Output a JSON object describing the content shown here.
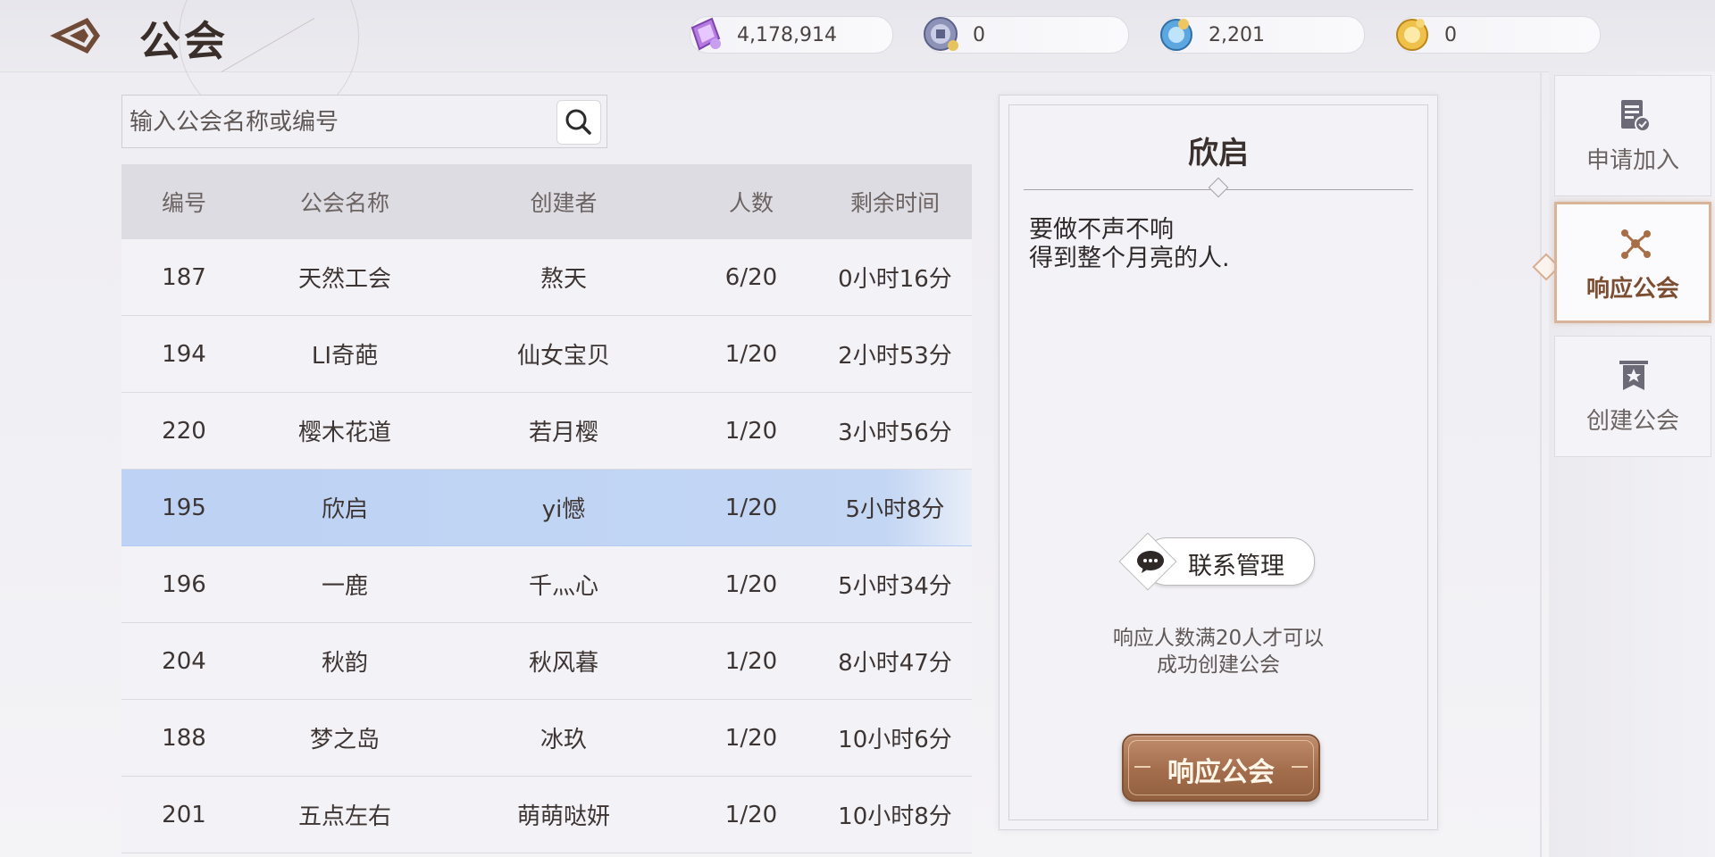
{
  "header": {
    "title": "公会",
    "back_icon": "back-arrow-icon"
  },
  "currencies": [
    {
      "name": "crystal",
      "icon": "crystal-icon",
      "value": "4,178,914"
    },
    {
      "name": "silver-coin",
      "icon": "coin-icon",
      "value": "0"
    },
    {
      "name": "blue-orb",
      "icon": "blue-orb-icon",
      "value": "2,201"
    },
    {
      "name": "gold-orb",
      "icon": "gold-orb-icon",
      "value": "0"
    }
  ],
  "search": {
    "placeholder": "输入公会名称或编号",
    "value": "",
    "icon": "search-icon"
  },
  "table": {
    "headers": [
      "编号",
      "公会名称",
      "创建者",
      "人数",
      "剩余时间"
    ],
    "rows": [
      {
        "id": "187",
        "name": "天然工会",
        "creator": "熬天",
        "members": "6/20",
        "time": "0小时16分"
      },
      {
        "id": "194",
        "name": "LI奇葩",
        "creator": "仙女宝贝",
        "members": "1/20",
        "time": "2小时53分"
      },
      {
        "id": "220",
        "name": "樱木花道",
        "creator": "若月樱",
        "members": "1/20",
        "time": "3小时56分"
      },
      {
        "id": "195",
        "name": "欣启",
        "creator": "yi憾",
        "members": "1/20",
        "time": "5小时8分"
      },
      {
        "id": "196",
        "name": "一鹿",
        "creator": "千灬心",
        "members": "1/20",
        "time": "5小时34分"
      },
      {
        "id": "204",
        "name": "秋韵",
        "creator": "秋风暮",
        "members": "1/20",
        "time": "8小时47分"
      },
      {
        "id": "188",
        "name": "梦之岛",
        "creator": "冰玖",
        "members": "1/20",
        "time": "10小时6分"
      },
      {
        "id": "201",
        "name": "五点左右",
        "creator": "萌萌哒妍",
        "members": "1/20",
        "time": "10小时8分"
      }
    ],
    "selected_row_index": 3
  },
  "detail": {
    "guild_name": "欣启",
    "motto": "要做不声不响\n得到整个月亮的人.",
    "contact_label": "联系管理",
    "hint": "响应人数满20人才可以\n成功创建公会",
    "respond_label": "响应公会"
  },
  "tabs": [
    {
      "label": "申请加入",
      "icon": "apply-document-icon",
      "active": false
    },
    {
      "label": "响应公会",
      "icon": "network-nodes-icon",
      "active": true
    },
    {
      "label": "创建公会",
      "icon": "banner-star-icon",
      "active": false
    }
  ],
  "colors": {
    "selected_row": "#bdd2f4",
    "accent_bronze": "#a36d4c",
    "active_tab_border": "#d8b49b"
  }
}
